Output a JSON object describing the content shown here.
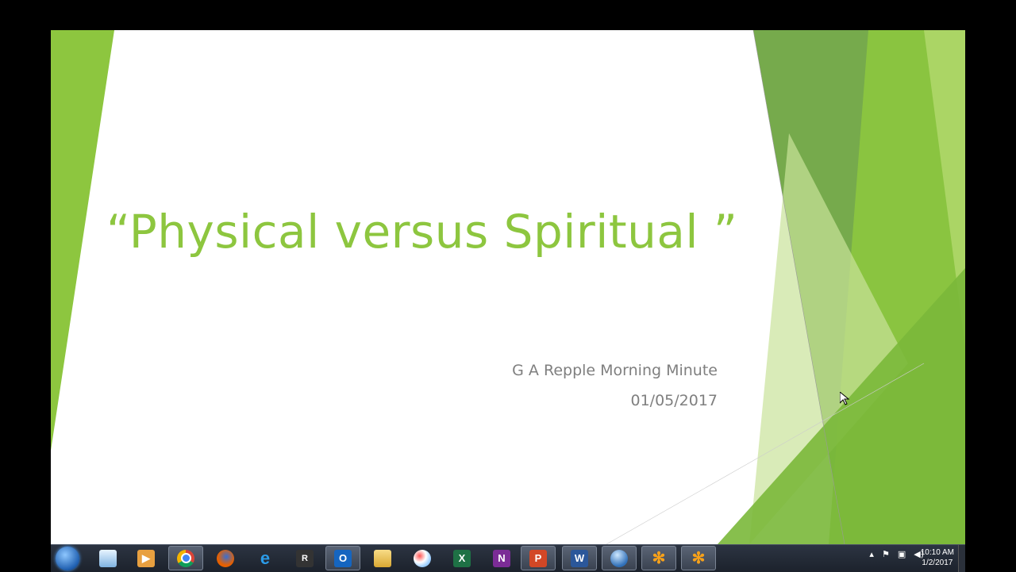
{
  "slide": {
    "title": "“Physical versus Spiritual ”",
    "subtitle": "G A Repple Morning Minute",
    "date": "01/05/2017"
  },
  "colors": {
    "title": "#8dc63f",
    "subtitle": "#7f7f7f",
    "green_light": "#c9e39a",
    "green_mid": "#8dc63f",
    "green_dark": "#5e9b2d"
  },
  "taskbar": {
    "apps": [
      {
        "name": "chrome",
        "label": ""
      },
      {
        "name": "firefox",
        "label": ""
      },
      {
        "name": "internet-explorer",
        "label": "e"
      },
      {
        "name": "r-app",
        "label": "R"
      },
      {
        "name": "outlook",
        "label": "O"
      },
      {
        "name": "file-explorer",
        "label": ""
      },
      {
        "name": "paint",
        "label": ""
      },
      {
        "name": "excel",
        "label": "X"
      },
      {
        "name": "onenote",
        "label": "N"
      },
      {
        "name": "powerpoint",
        "label": "P"
      },
      {
        "name": "word",
        "label": "W"
      },
      {
        "name": "network-app",
        "label": ""
      },
      {
        "name": "flower-app-1",
        "label": "✻"
      },
      {
        "name": "flower-app-2",
        "label": "✻"
      }
    ],
    "clock": {
      "time": "10:10 AM",
      "date": "1/2/2017"
    }
  }
}
